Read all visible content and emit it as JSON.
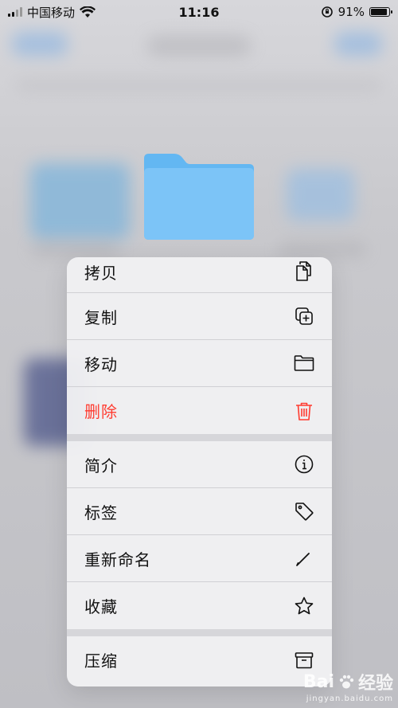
{
  "status_bar": {
    "carrier": "中国移动",
    "time": "11:16",
    "battery_percent": "91%",
    "battery_level": 0.91
  },
  "menu": {
    "items": [
      {
        "label": "拷贝",
        "icon": "copy-documents-icon"
      },
      {
        "label": "复制",
        "icon": "duplicate-plus-icon"
      },
      {
        "label": "移动",
        "icon": "folder-icon"
      },
      {
        "label": "删除",
        "icon": "trash-icon",
        "destructive": true
      },
      {
        "label": "简介",
        "icon": "info-circle-icon"
      },
      {
        "label": "标签",
        "icon": "tag-icon"
      },
      {
        "label": "重新命名",
        "icon": "pencil-icon"
      },
      {
        "label": "收藏",
        "icon": "star-icon"
      },
      {
        "label": "压缩",
        "icon": "archive-box-icon"
      }
    ]
  },
  "colors": {
    "destructive": "#ff3b30",
    "folder": "#7cc4f7",
    "menu_bg": "#f0f0f2"
  },
  "watermark": {
    "brand": "Bai",
    "brand_suffix": "经验",
    "url": "jingyan.baidu.com"
  }
}
